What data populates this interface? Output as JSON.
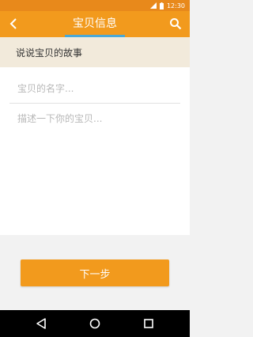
{
  "status_bar": {
    "time": "12:30",
    "icons": [
      "signal-icon",
      "battery-icon"
    ]
  },
  "app_bar": {
    "title": "宝贝信息",
    "back_icon": "back-arrow-icon",
    "search_icon": "search-icon",
    "accent": "#f29a1d",
    "underline_color": "#4aa8d6"
  },
  "section": {
    "header": "说说宝贝的故事"
  },
  "form": {
    "name_placeholder": "宝贝的名字...",
    "name_value": "",
    "description_placeholder": "描述一下你的宝贝...",
    "description_value": ""
  },
  "actions": {
    "next_label": "下一步"
  },
  "nav": {
    "icons": [
      "back-triangle-icon",
      "home-circle-icon",
      "recent-square-icon"
    ]
  }
}
